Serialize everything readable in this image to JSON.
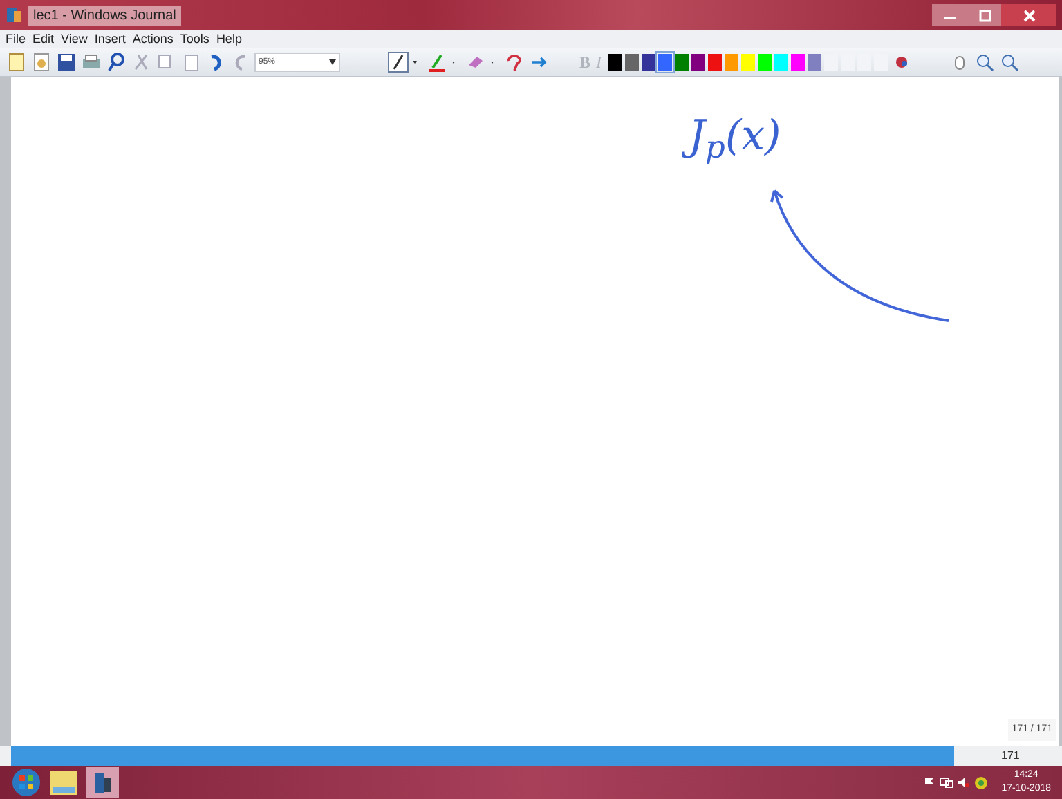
{
  "window": {
    "title": "lec1 - Windows Journal"
  },
  "menu": [
    "File",
    "Edit",
    "View",
    "Insert",
    "Actions",
    "Tools",
    "Help"
  ],
  "toolbar": {
    "zoom": "95%",
    "text_tools": [
      "B",
      "I"
    ],
    "colors": [
      {
        "color": "#000000",
        "selected": false
      },
      {
        "color": "#666666",
        "selected": false
      },
      {
        "color": "#333399",
        "selected": false
      },
      {
        "color": "#3366ff",
        "selected": true
      },
      {
        "color": "#008000",
        "selected": false
      },
      {
        "color": "#800080",
        "selected": false
      },
      {
        "color": "#ee1111",
        "selected": false
      },
      {
        "color": "#ff9900",
        "selected": false
      },
      {
        "color": "#ffff00",
        "selected": false
      },
      {
        "color": "#00ff00",
        "selected": false
      },
      {
        "color": "#00ffff",
        "selected": false
      },
      {
        "color": "#ff00ff",
        "selected": false
      },
      {
        "color": "#8080c0",
        "selected": false
      },
      {
        "color": "#f2f4f7",
        "selected": false
      },
      {
        "color": "#f2f4f7",
        "selected": false
      },
      {
        "color": "#f2f4f7",
        "selected": false
      },
      {
        "color": "#f2f4f7",
        "selected": false
      }
    ]
  },
  "page": {
    "ink_text": "J$_{p}$(x)",
    "page_counter": "171 / 171"
  },
  "status_bar": {
    "page": "171"
  },
  "taskbar": {
    "time": "14:24",
    "date": "17-10-2018"
  }
}
